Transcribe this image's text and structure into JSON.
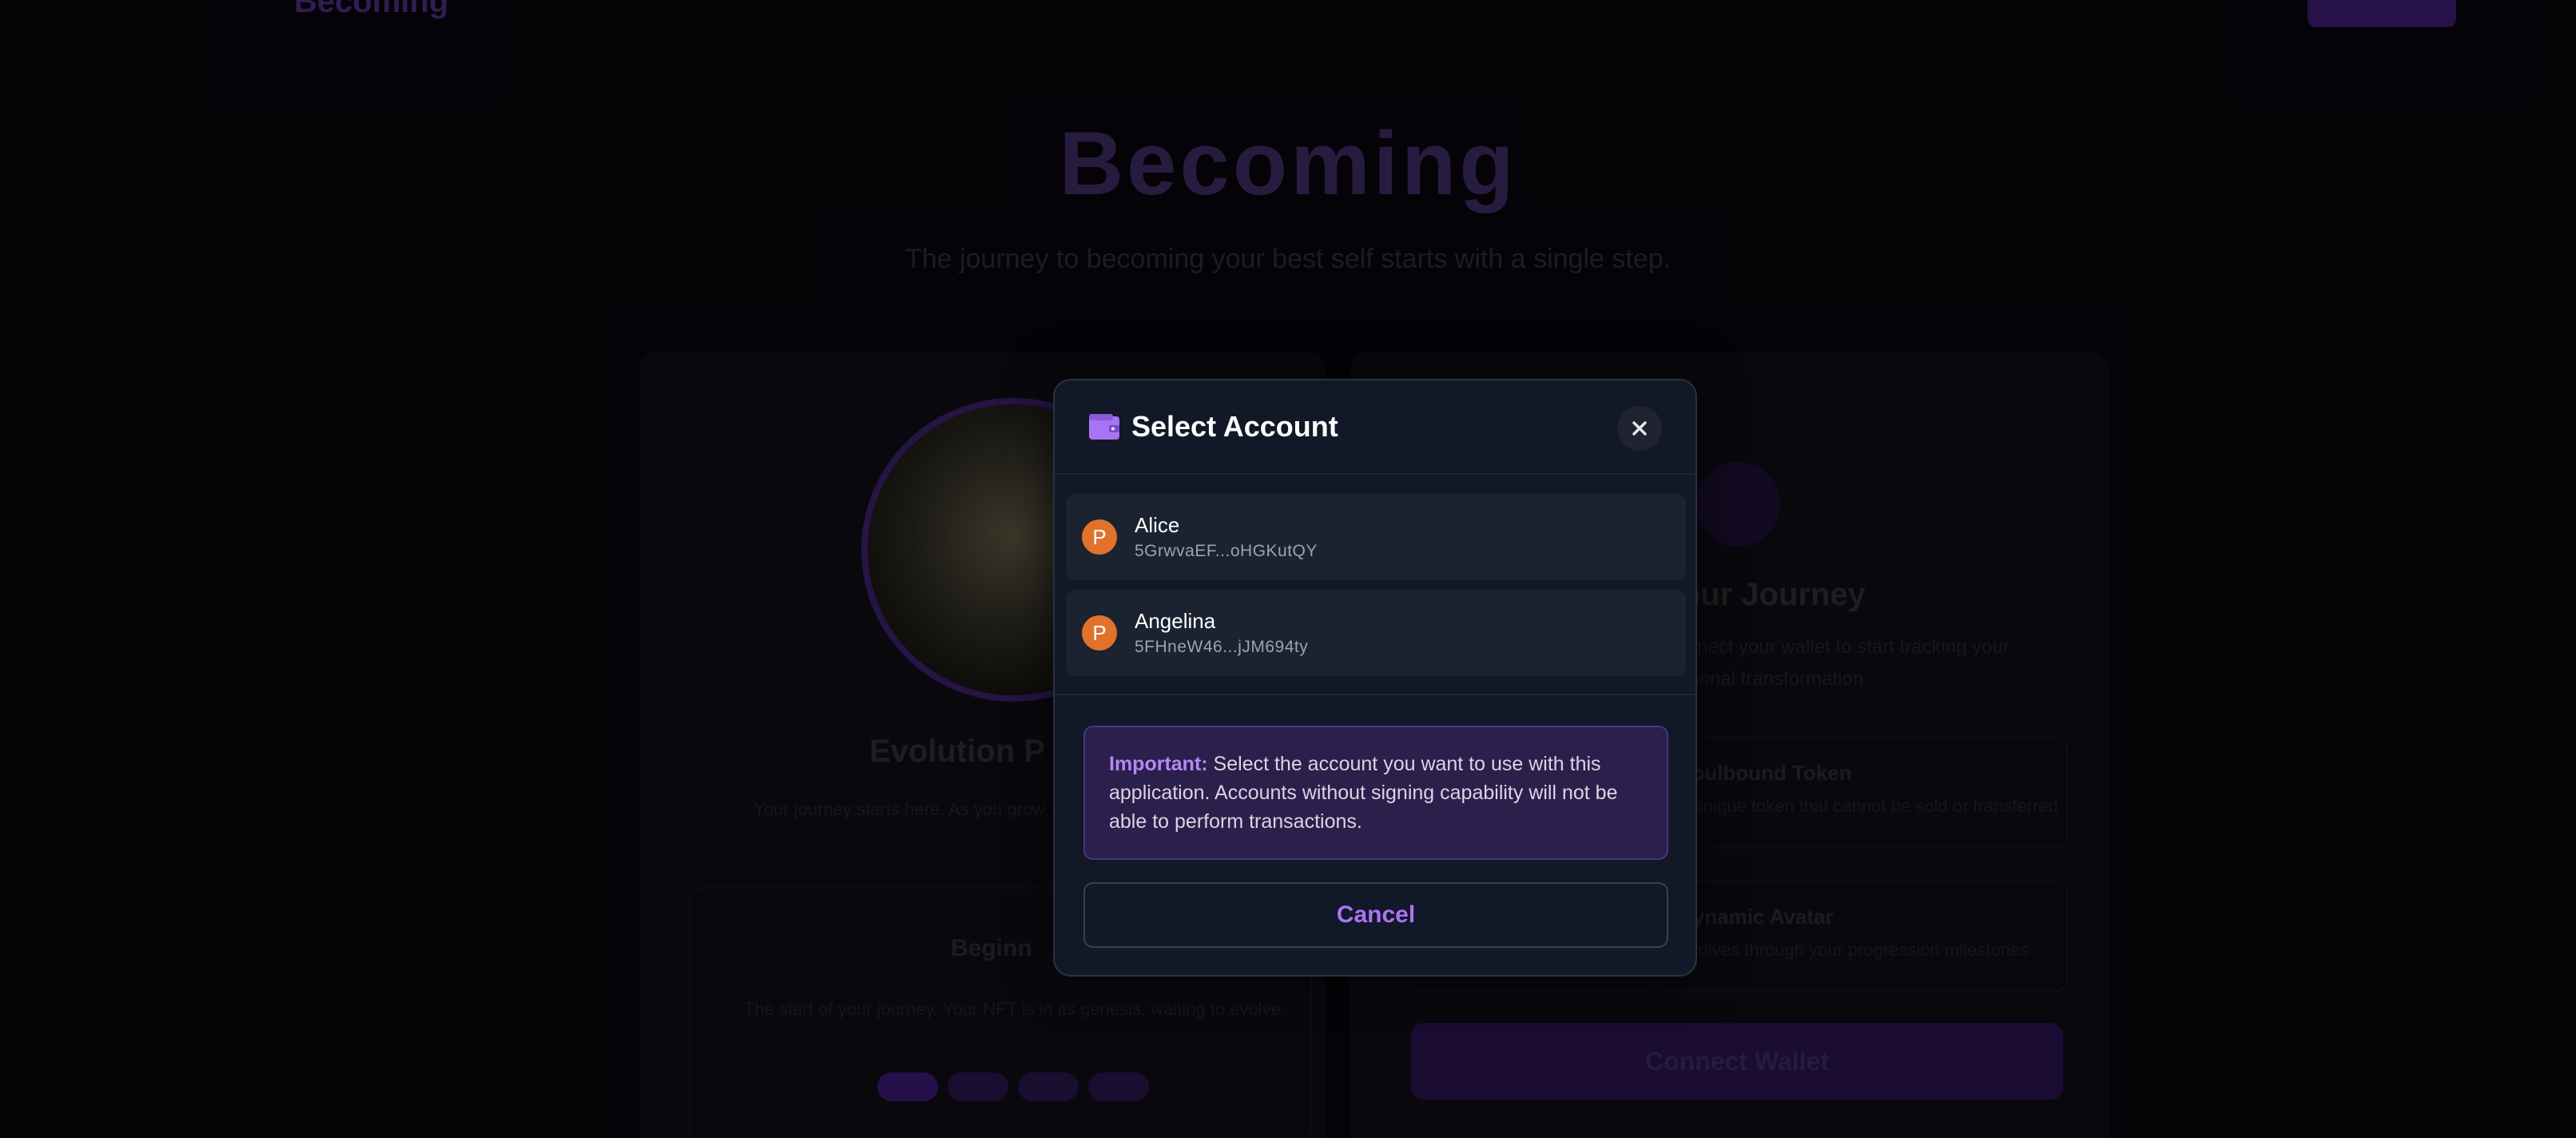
{
  "background": {
    "logo": "Becoming",
    "title": "Becoming",
    "subtitle": "The journey to becoming your best self starts with a single step.",
    "left_card": {
      "heading": "Evolution P",
      "text": "Your journey starts here. As you grow, your NFT will evolve",
      "inner_heading": "Beginn",
      "inner_text": "The start of your journey. Your NFT is in its genesis, waiting to evolve."
    },
    "right_card": {
      "heading": "Your Journey",
      "text": "Connect your wallet to start tracking your personal transformation",
      "feature_1_title": "Soulbound Token",
      "feature_1_text": "A unique token that cannot be sold or transferred",
      "feature_2_title": "Dynamic Avatar",
      "feature_2_text": "Evolves through your progression milestones",
      "connect_label": "Connect Wallet"
    }
  },
  "modal": {
    "title": "Select Account",
    "icons": {
      "title_icon": "wallet-icon",
      "close_icon": "close-icon"
    },
    "accounts": [
      {
        "avatar_letter": "P",
        "name": "Alice",
        "address": "5GrwvaEF...oHGKutQY"
      },
      {
        "avatar_letter": "P",
        "name": "Angelina",
        "address": "5FHneW46...jJM694ty"
      }
    ],
    "notice": {
      "strong": "Important:",
      "text": " Select the account you want to use with this application. Accounts without signing capability will not be able to perform transactions."
    },
    "cancel_label": "Cancel"
  },
  "colors": {
    "accent": "#a874f4",
    "modal_bg": "#111827",
    "account_avatar": "#e2722b",
    "notice_bg": "#2b1f4b"
  }
}
